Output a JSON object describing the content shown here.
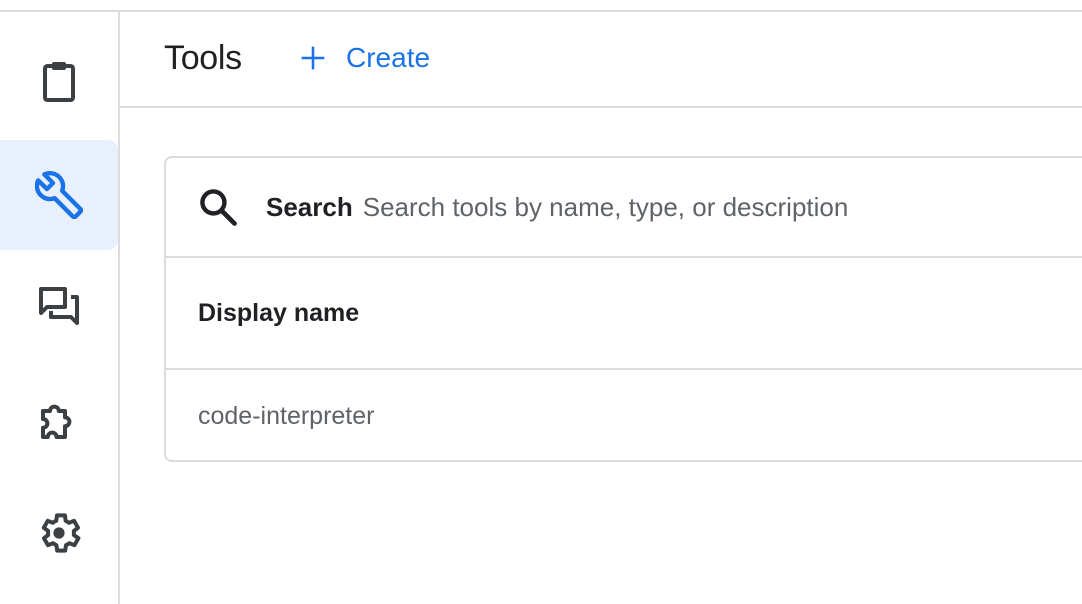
{
  "rail": {
    "items": [
      {
        "icon": "clipboard-icon",
        "active": false
      },
      {
        "icon": "wrench-icon",
        "active": true
      },
      {
        "icon": "forum-icon",
        "active": false
      },
      {
        "icon": "extension-icon",
        "active": false
      },
      {
        "icon": "gear-icon",
        "active": false
      }
    ],
    "active_color": "#1a73e8",
    "active_bg": "#e8f0fe"
  },
  "header": {
    "title": "Tools",
    "create_label": "Create",
    "create_icon": "plus-icon"
  },
  "search": {
    "icon": "search-icon",
    "label": "Search",
    "placeholder": "Search tools by name, type, or description",
    "value": ""
  },
  "table": {
    "columns": [
      "Display name"
    ],
    "rows": [
      {
        "display_name": "code-interpreter"
      }
    ]
  },
  "colors": {
    "accent": "#1a73e8",
    "text": "#202124",
    "muted": "#5f6368",
    "divider": "#dadce0"
  }
}
